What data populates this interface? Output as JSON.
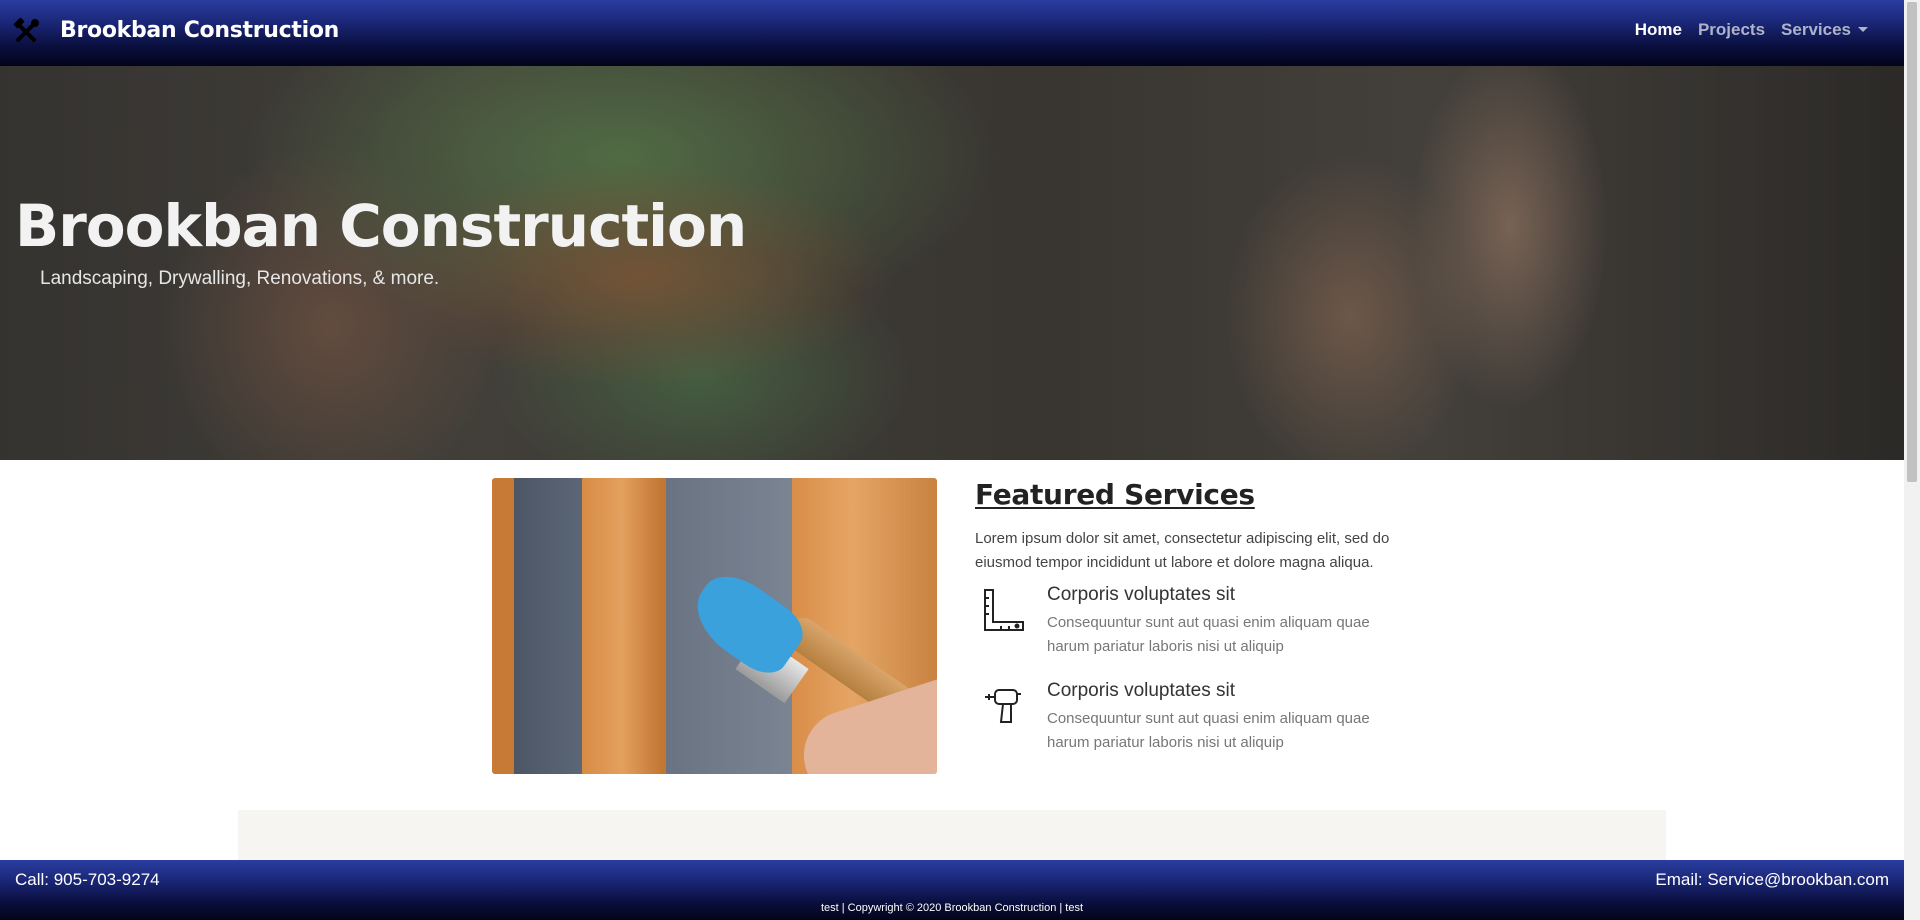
{
  "navbar": {
    "brand": "Brookban Construction",
    "brand_icon": "hammer-wrench-icon",
    "links": [
      {
        "label": "Home",
        "active": true
      },
      {
        "label": "Projects",
        "active": false
      },
      {
        "label": "Services",
        "active": false,
        "dropdown": true
      }
    ]
  },
  "hero": {
    "title": "Brookban Construction",
    "subtitle": "Landscaping, Drywalling, Renovations, & more."
  },
  "featured": {
    "title": "Featured Services",
    "intro": "Lorem ipsum dolor sit amet, consectetur adipiscing elit, sed do eiusmod tempor incididunt ut labore et dolore magna aliqua.",
    "items": [
      {
        "icon": "ruler-square-icon",
        "heading": "Corporis voluptates sit",
        "text": "Consequuntur sunt aut quasi enim aliquam quae harum pariatur laboris nisi ut aliquip"
      },
      {
        "icon": "drill-icon",
        "heading": "Corporis voluptates sit",
        "text": "Consequuntur sunt aut quasi enim aliquam quae harum pariatur laboris nisi ut aliquip"
      }
    ]
  },
  "footer": {
    "call": "Call: 905-703-9274",
    "email": "Email: Service@brookban.com",
    "copyright": "test | Copywright © 2020 Brookban Construction | test"
  },
  "colors": {
    "nav_gradient_top": "#2a3da0",
    "nav_gradient_bottom": "#020418",
    "band": "#f6f5f1"
  }
}
